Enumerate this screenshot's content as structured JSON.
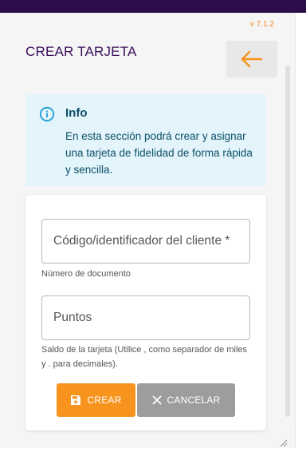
{
  "header": {
    "version": "v 7.1.2",
    "title": "CREAR TARJETA",
    "back_icon": "arrow-left-icon"
  },
  "info": {
    "icon": "info-circle-icon",
    "title": "Info",
    "text": "En esta sección podrá crear y asignar una tarjeta de fidelidad de forma rápida y sencilla."
  },
  "form": {
    "code_field": {
      "placeholder": "Código/identificador del cliente *",
      "value": "",
      "helper": "Número de documento"
    },
    "points_field": {
      "placeholder": "Puntos",
      "value": "",
      "helper": "Saldo de la tarjeta (Utilice , como separador de miles y . para decimales)."
    },
    "create_button": {
      "label": "CREAR",
      "icon": "save-icon"
    },
    "cancel_button": {
      "label": "CANCELAR",
      "icon": "close-icon"
    }
  },
  "colors": {
    "accent": "#f7941d",
    "title": "#3b0f5c",
    "top_bar": "#2c0e4a",
    "info_bg": "#e3f4fb",
    "info_text": "#0c4f68",
    "cancel": "#9d9d9d"
  }
}
